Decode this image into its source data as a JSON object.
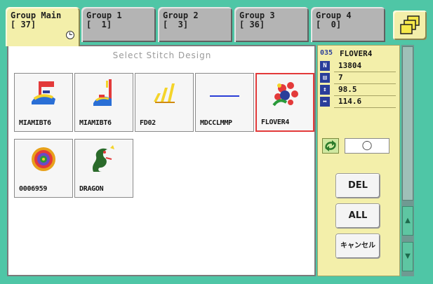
{
  "tabs": [
    {
      "name": "Group Main",
      "count": "[ 37]",
      "active": true
    },
    {
      "name": "Group 1",
      "count": "[  1]",
      "active": false
    },
    {
      "name": "Group 2",
      "count": "[  3]",
      "active": false
    },
    {
      "name": "Group 3",
      "count": "[ 36]",
      "active": false
    },
    {
      "name": "Group 4",
      "count": "[  0]",
      "active": false
    }
  ],
  "header": {
    "title": "Select Stitch Design"
  },
  "designs": [
    {
      "label": "MIAMIBT6",
      "icon": "flag-icon",
      "selected": false
    },
    {
      "label": "MIAMIBT6",
      "icon": "flag-icon",
      "selected": false
    },
    {
      "label": "FD02",
      "icon": "stripes-icon",
      "selected": false
    },
    {
      "label": "MDCCLMMP",
      "icon": "line-icon",
      "selected": false
    },
    {
      "label": "FLOVER4",
      "icon": "flower-icon",
      "selected": true
    },
    {
      "label": "0006959",
      "icon": "floral-badge-icon",
      "selected": false
    },
    {
      "label": "DRAGON",
      "icon": "dragon-icon",
      "selected": false
    }
  ],
  "info": {
    "design_number": "035",
    "design_name": "FLOVER4",
    "stitches": "13804",
    "colors": "7",
    "height": "98.5",
    "width": "114.6"
  },
  "field_value": "◯",
  "buttons": {
    "del": "DEL",
    "all": "ALL",
    "cancel": "キャンセル"
  },
  "colors": {
    "background": "#4fc6a6",
    "panel": "#f3efaa",
    "selection": "#e33a3a"
  }
}
